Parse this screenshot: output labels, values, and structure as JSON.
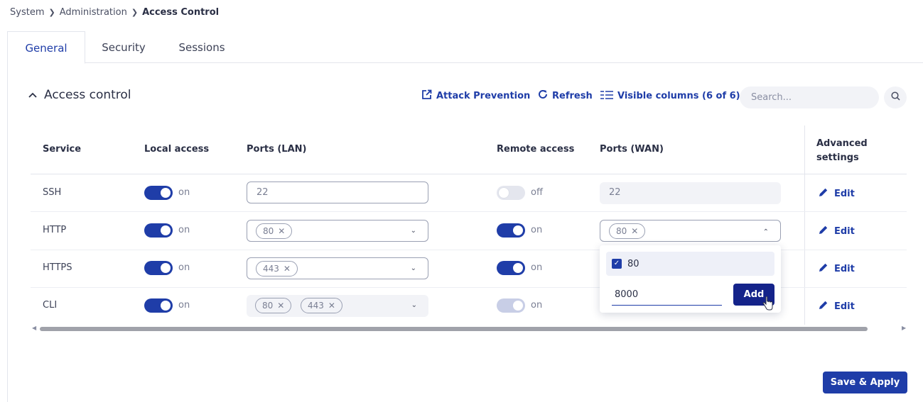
{
  "breadcrumb": {
    "items": [
      "System",
      "Administration"
    ],
    "current": "Access Control",
    "separator": "❯"
  },
  "tabs": [
    {
      "label": "General",
      "active": true
    },
    {
      "label": "Security",
      "active": false
    },
    {
      "label": "Sessions",
      "active": false
    }
  ],
  "section": {
    "title": "Access control",
    "collapse_icon": "⌃"
  },
  "toolbar": {
    "attack_prevention": "Attack Prevention",
    "refresh": "Refresh",
    "visible_columns": "Visible columns (6 of 6)",
    "search_placeholder": "Search..."
  },
  "table": {
    "columns": [
      "Service",
      "Local access",
      "Ports (LAN)",
      "Remote access",
      "Ports (WAN)",
      "Advanced settings"
    ],
    "rows": [
      {
        "service": "SSH",
        "local": "on",
        "lan_value": "22",
        "remote": "off",
        "wan_value": "22",
        "edit": "Edit"
      },
      {
        "service": "HTTP",
        "local": "on",
        "lan_chips": [
          "80"
        ],
        "remote": "on",
        "wan_chips": [
          "80"
        ],
        "edit": "Edit"
      },
      {
        "service": "HTTPS",
        "local": "on",
        "lan_chips": [
          "443"
        ],
        "remote": "on",
        "edit": "Edit"
      },
      {
        "service": "CLI",
        "local": "on",
        "lan_chips": [
          "80",
          "443"
        ],
        "remote": "on",
        "edit": "Edit"
      }
    ]
  },
  "dropdown": {
    "option": "80",
    "option_checked": true,
    "input_value": "8000",
    "add_label": "Add"
  },
  "actions": {
    "save_apply": "Save & Apply"
  },
  "colors": {
    "accent": "#1f3da8",
    "accent_dark": "#14238a",
    "border": "#e3e5ec"
  }
}
